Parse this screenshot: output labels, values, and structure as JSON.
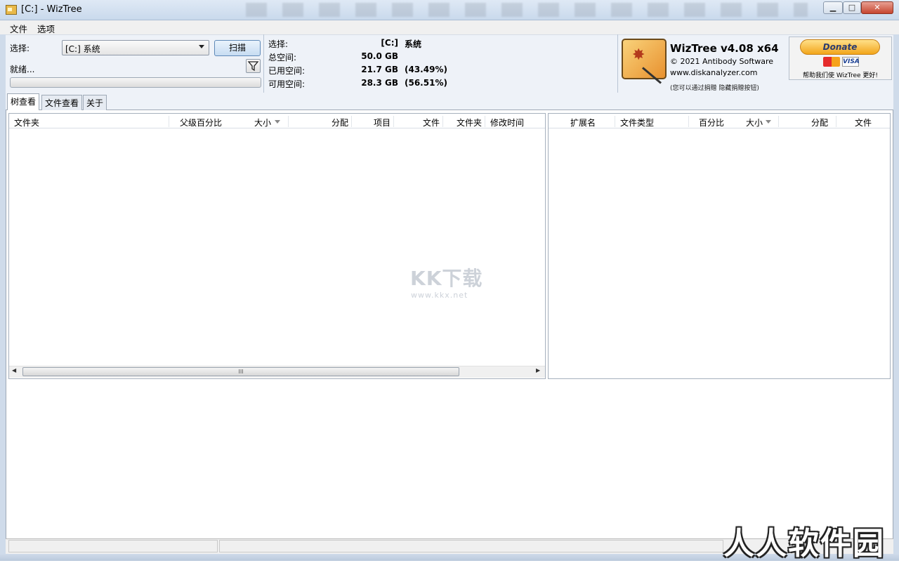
{
  "window": {
    "title": "[C:]  - WizTree"
  },
  "menu": [
    "文件",
    "选项"
  ],
  "scan_panel": {
    "select_label": "选择:",
    "drive_value": "[C:] 系统",
    "scan_button": "扫描",
    "status": "就绪..."
  },
  "drive_info": {
    "rows": [
      {
        "label": "选择:",
        "value": "[C:]",
        "extra": "系统"
      },
      {
        "label": "总空间:",
        "value": "50.0 GB",
        "extra": ""
      },
      {
        "label": "已用空间:",
        "value": "21.7 GB",
        "extra": "(43.49%)"
      },
      {
        "label": "可用空间:",
        "value": "28.3 GB",
        "extra": "(56.51%)"
      }
    ]
  },
  "about": {
    "app_name": "WizTree v4.08 x64",
    "copyright": "© 2021 Antibody Software",
    "website": "www.diskanalyzer.com",
    "donate_hint": "(您可以通过捐赠 隐藏捐赠按钮)"
  },
  "donate": {
    "button": "Donate",
    "visa": "VISA",
    "caption": "帮助我们使 WizTree 更好!"
  },
  "tabs": [
    "树查看",
    "文件查看",
    "关于"
  ],
  "folder_columns": [
    "文件夹",
    "父级百分比",
    "大小",
    "分配",
    "项目",
    "文件",
    "文件夹",
    "修改时间"
  ],
  "ext_columns": [
    "扩展名",
    "文件类型",
    "百分比",
    "大小",
    "分配",
    "文件"
  ],
  "scrollbar": {
    "grip": "III"
  },
  "watermarks": {
    "center": "KK下载",
    "center_url": "www.kkx.net",
    "corner": "人人软件园"
  }
}
